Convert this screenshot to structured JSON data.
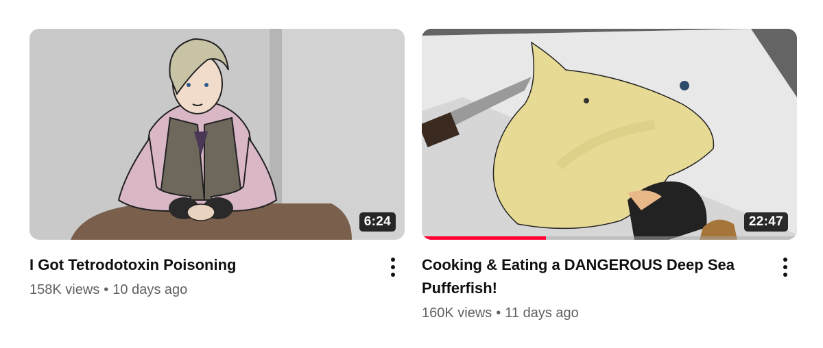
{
  "videos": [
    {
      "title": "I Got Tetrodotoxin Poisoning",
      "views": "158K views",
      "separator": "•",
      "age": "10 days ago",
      "duration": "6:24",
      "watched_fraction": 0
    },
    {
      "title": "Cooking & Eating a DANGEROUS Deep Sea Pufferfish!",
      "views": "160K views",
      "separator": "•",
      "age": "11 days ago",
      "duration": "22:47",
      "watched_fraction": 0.33
    }
  ],
  "icons": {
    "menu": "more-vert-icon"
  },
  "colors": {
    "progress": "#ff0033",
    "title": "#0f0f0f",
    "meta": "#606060"
  }
}
